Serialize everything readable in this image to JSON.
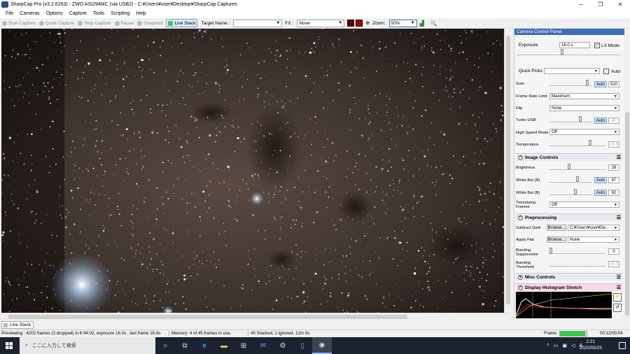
{
  "window": {
    "title": "SharpCap Pro (v3.2.6263) - ZWO ASI294MC (via USB2) - C:¥Users¥user¥Desktop¥SharpCap Captures",
    "min": "─",
    "max": "❐",
    "close": "✕"
  },
  "menu": [
    "File",
    "Cameras",
    "Options",
    "Capture",
    "Tools",
    "Scripting",
    "Help"
  ],
  "toolbar": {
    "start_capture": "Start Capture",
    "quick_capture": "Quick Capture",
    "stop_capture": "Stop Capture",
    "pause": "Pause",
    "snapshot": "Snapshot",
    "live_stack": "Live Stack",
    "target_name_label": "Target Name :",
    "target_name_value": "",
    "fx_label": "FX :",
    "fx_value": "None",
    "zoom_label": "Zoom:",
    "zoom_value": "50%"
  },
  "panel": {
    "title": "Camera Control Panel",
    "exposure_label": "Exposure",
    "exposure_value": "16.0 s",
    "lx_mode_label": "LX Mode",
    "quick_picks_label": "Quick Picks",
    "quick_picks_value": "",
    "auto_label": "Auto",
    "gain_label": "Gain",
    "gain_auto": "Auto",
    "gain_value": "520",
    "frame_rate_label": "Frame Rate Limit",
    "frame_rate_value": "Maximum",
    "flip_label": "Flip",
    "flip_value": "None",
    "turbo_label": "Turbo USB",
    "turbo_auto": "Auto",
    "turbo_value": "80",
    "high_speed_label": "High Speed Mode",
    "high_speed_value": "Off",
    "temperature_label": "Temperature",
    "temperature_value": "21.8",
    "image_controls_title": "Image Controls",
    "brightness_label": "Brightness",
    "brightness_value": "28",
    "wb_r_label": "White Bal (R)",
    "wb_r_auto": "Auto",
    "wb_r_value": "67",
    "wb_b_label": "White Bal (B)",
    "wb_b_auto": "Auto",
    "wb_b_value": "62",
    "timestamp_label": "Timestamp Frames",
    "timestamp_value": "Off",
    "preprocessing_title": "Preprocessing",
    "subtract_dark_label": "Subtract Dark",
    "browse_label": "Browse...",
    "subtract_dark_value": "C:¥Users¥user¥De...",
    "apply_flat_label": "Apply Flat",
    "browse2_label": "Browse...",
    "apply_flat_value": "None",
    "banding_supp_label": "Banding Suppression",
    "banding_supp_value": "0",
    "banding_thresh_label": "Banding Threshold",
    "banding_thresh_value": "35.0",
    "misc_title": "Misc Controls",
    "histogram_title": "Display Histogram Stretch"
  },
  "bottom_tab": "Live Stack",
  "status": {
    "preview": "Previewing : 4202 frames (3 dropped) in 6:44:02, exposure 16.0s , last frame 16.9s",
    "memory": "Memory: 4 of 45 frames in use.",
    "stacked": "45 Stacked, 1 Ignored, 12m 0s",
    "frame_label": "Frame:",
    "frame_progress": 0.95,
    "frame_time": "00:12/00:04"
  },
  "taskbar": {
    "search_placeholder": "ここに入力して検索",
    "time": "2:21",
    "date": "2020/05/25",
    "ime": "A"
  }
}
